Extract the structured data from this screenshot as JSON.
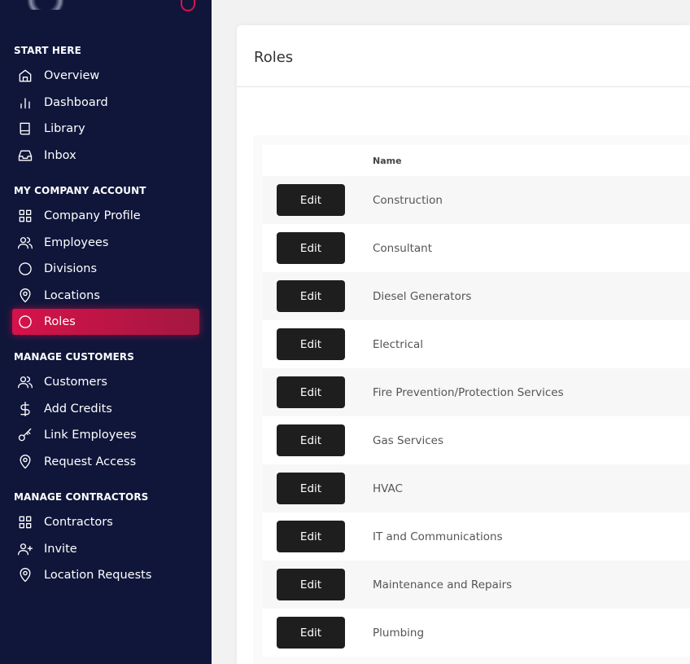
{
  "sidebar": {
    "sections": [
      {
        "title": "START HERE",
        "items": [
          {
            "label": "Overview",
            "icon": "home"
          },
          {
            "label": "Dashboard",
            "icon": "bar-chart"
          },
          {
            "label": "Library",
            "icon": "book"
          },
          {
            "label": "Inbox",
            "icon": "inbox"
          }
        ]
      },
      {
        "title": "MY COMPANY ACCOUNT",
        "items": [
          {
            "label": "Company Profile",
            "icon": "grid"
          },
          {
            "label": "Employees",
            "icon": "users"
          },
          {
            "label": "Divisions",
            "icon": "circle"
          },
          {
            "label": "Locations",
            "icon": "map-pin"
          },
          {
            "label": "Roles",
            "icon": "circle",
            "active": true
          }
        ]
      },
      {
        "title": "MANAGE CUSTOMERS",
        "items": [
          {
            "label": "Customers",
            "icon": "users"
          },
          {
            "label": "Add Credits",
            "icon": "dollar"
          },
          {
            "label": "Link Employees",
            "icon": "key"
          },
          {
            "label": "Request Access",
            "icon": "map-pin"
          }
        ]
      },
      {
        "title": "MANAGE CONTRACTORS",
        "items": [
          {
            "label": "Contractors",
            "icon": "grid"
          },
          {
            "label": "Invite",
            "icon": "user-plus"
          },
          {
            "label": "Location Requests",
            "icon": "map-pin"
          }
        ]
      }
    ]
  },
  "main": {
    "title": "Roles",
    "table": {
      "columns": [
        "",
        "Name"
      ],
      "edit_label": "Edit",
      "rows": [
        "Construction",
        "Consultant",
        "Diesel Generators",
        "Electrical",
        "Fire Prevention/Protection Services",
        "Gas Services",
        "HVAC",
        "IT and Communications",
        "Maintenance and Repairs",
        "Plumbing"
      ]
    }
  },
  "colors": {
    "sidebar": "#10163a",
    "accent": "#d6124a"
  }
}
